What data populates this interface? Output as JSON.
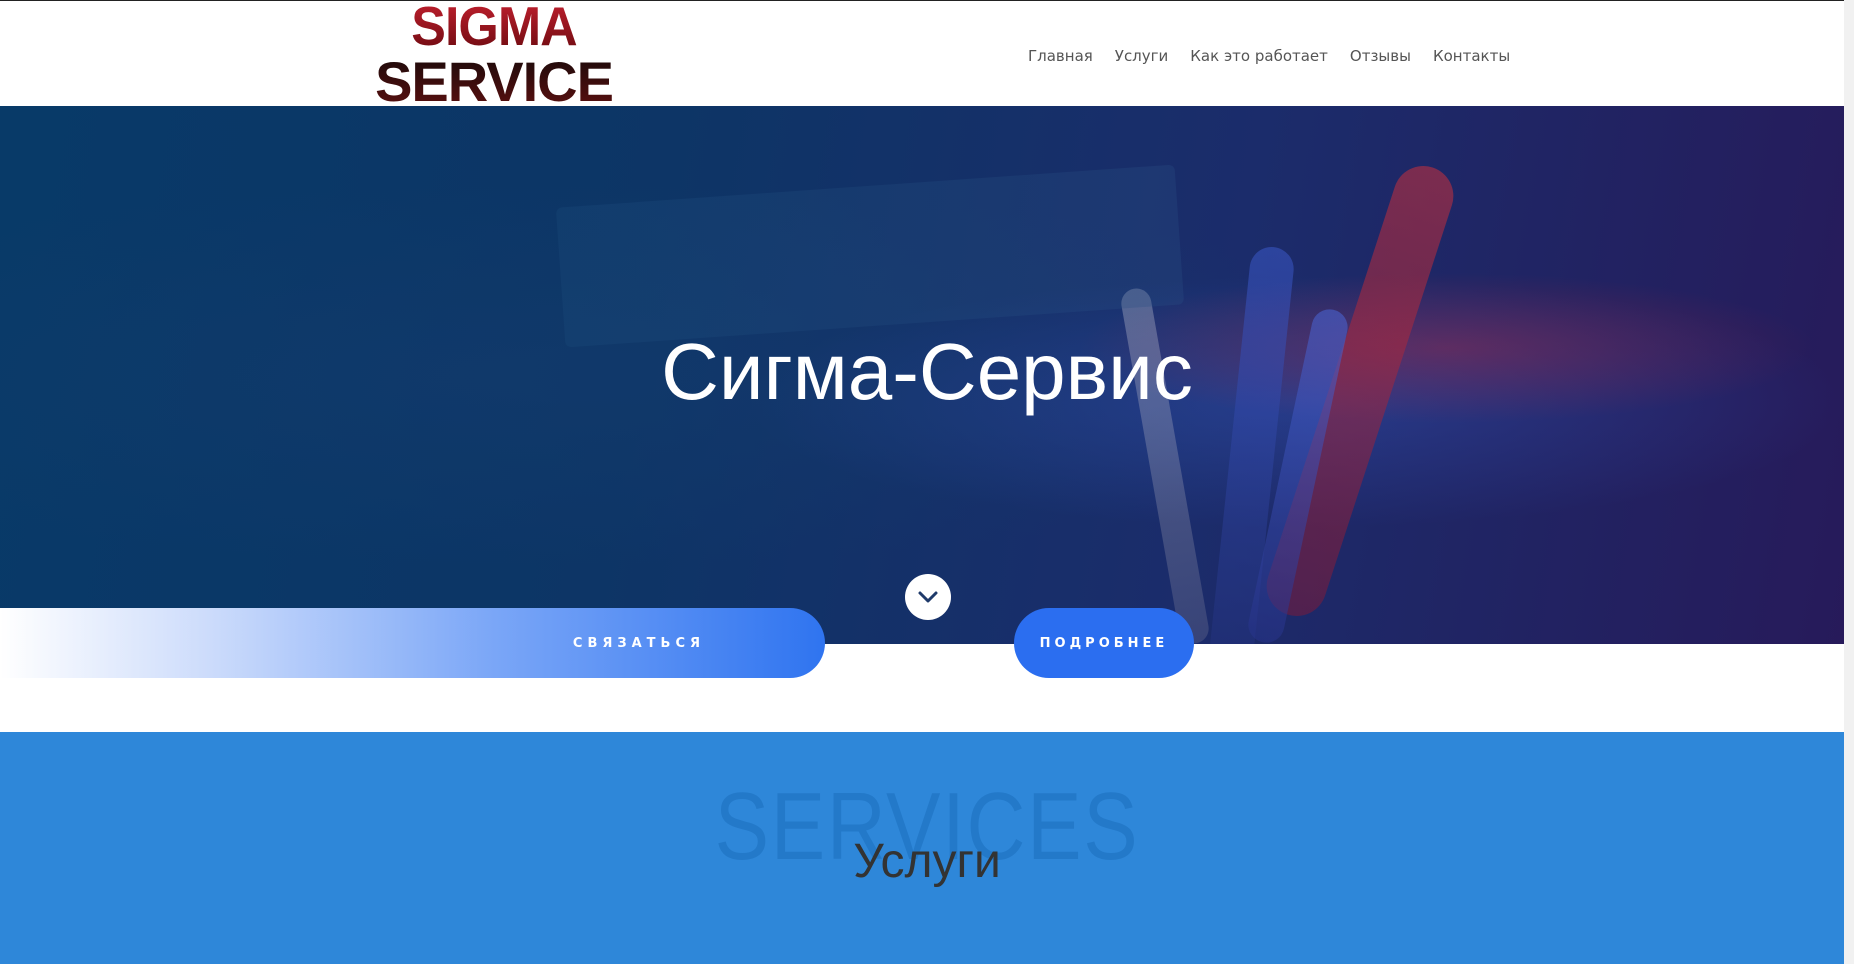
{
  "header": {
    "logo_line1": "SIGMA",
    "logo_line2": "SERVICE",
    "nav": [
      {
        "label": "Главная"
      },
      {
        "label": "Услуги"
      },
      {
        "label": "Как это работает"
      },
      {
        "label": "Отзывы"
      },
      {
        "label": "Контакты"
      }
    ]
  },
  "hero": {
    "title": "Сигма-Сервис",
    "contact_button": "СВЯЗАТЬСЯ",
    "more_button": "ПОДРОБНЕЕ",
    "scroll_icon": "chevron-down-icon"
  },
  "services": {
    "background_word": "SERVICES",
    "title": "Услуги"
  },
  "colors": {
    "accent_blue": "#2b6ef0",
    "services_bg": "#2e87d9",
    "logo_red": "#a0151f"
  }
}
